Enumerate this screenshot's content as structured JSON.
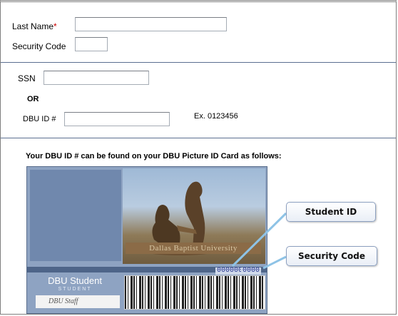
{
  "form": {
    "last_name_label": "Last Name",
    "required_mark": "*",
    "last_name_value": "",
    "security_code_label": "Security Code",
    "security_code_value": "",
    "ssn_label": "SSN",
    "ssn_value": "",
    "or_label": "OR",
    "dbu_id_label": "DBU ID #",
    "dbu_id_value": "",
    "dbu_id_example": "Ex. 0123456"
  },
  "id_card_help": {
    "heading": "Your DBU ID # can be found on your DBU Picture ID Card as follows:",
    "card_student_title": "DBU Student",
    "card_student_subtitle": "STUDENT",
    "card_plaque_text": "Dallas Baptist University",
    "card_id_number": "0000000",
    "card_security_number": "0000",
    "signature_text": "DBU Staff",
    "callout_student_id": "Student ID",
    "callout_security_code": "Security Code"
  },
  "colors": {
    "divider": "#5b6f91",
    "required": "#cc0000",
    "card_background": "#8ea3c2"
  }
}
